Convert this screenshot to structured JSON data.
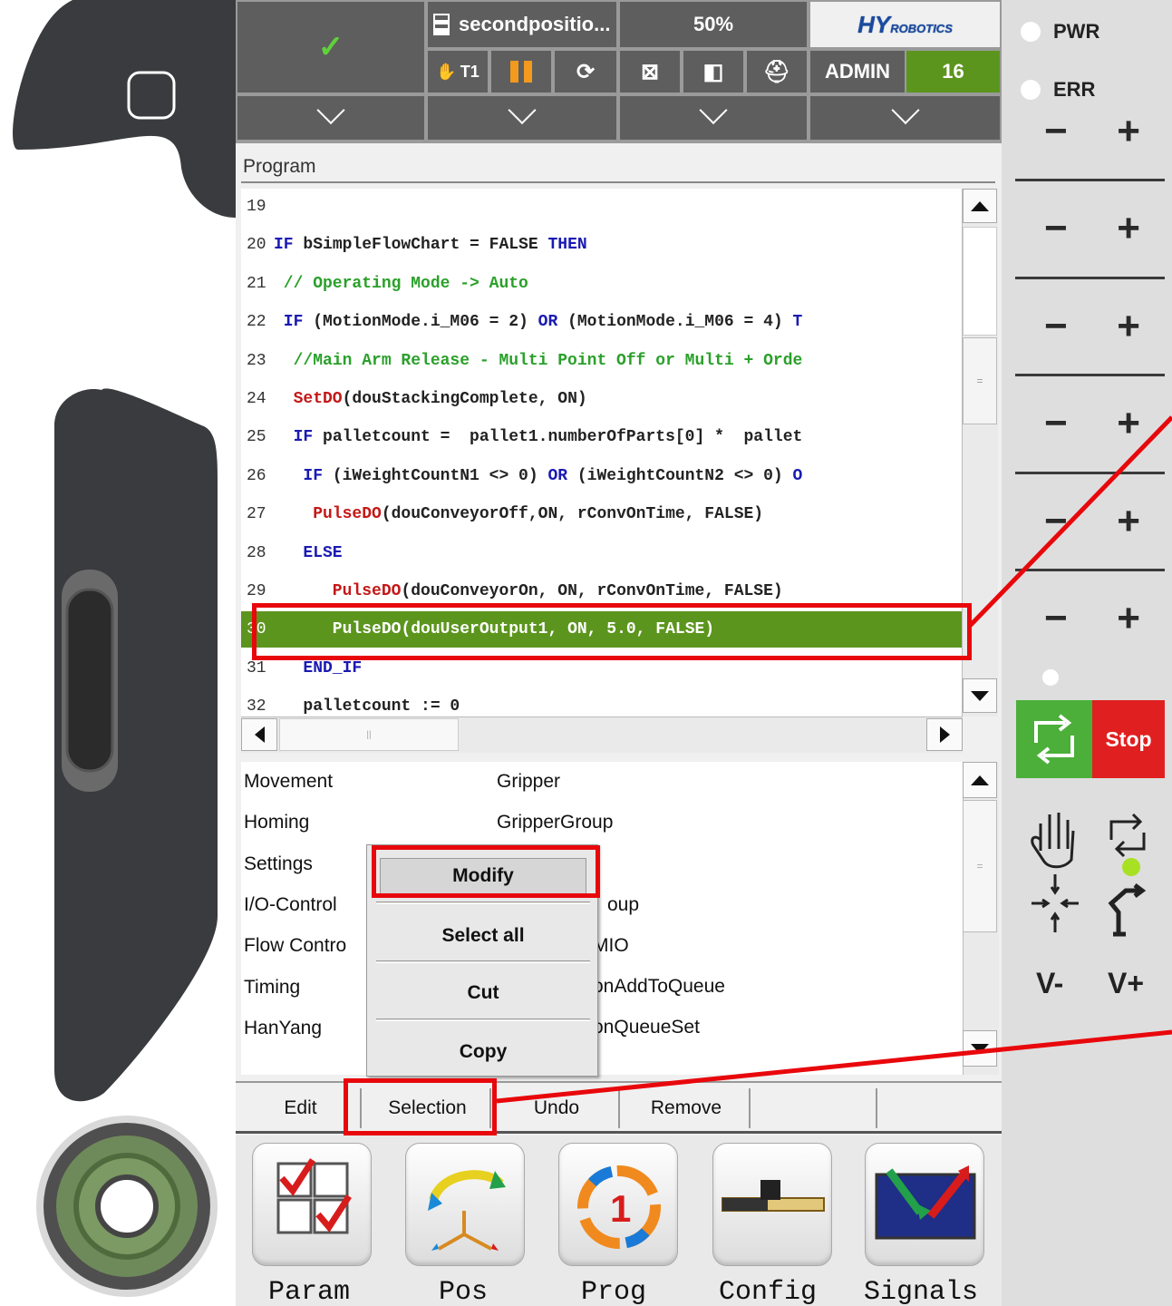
{
  "status_bar": {
    "program_name": "secondpositio...",
    "override": "50%",
    "brand": "HYROBOTICS",
    "mode": "T1",
    "user": "ADMIN",
    "user_level": "16"
  },
  "pendant": {
    "pwr_label": "PWR",
    "err_label": "ERR",
    "stop_label": "Stop",
    "v_minus": "V-",
    "v_plus": "V+"
  },
  "program": {
    "title": "Program",
    "lines": [
      {
        "n": "19",
        "parts": [
          {
            "c": "tx",
            "t": ""
          }
        ]
      },
      {
        "n": "20",
        "parts": [
          {
            "c": "kw",
            "t": "IF"
          },
          {
            "c": "tx",
            "t": " bSimpleFlowChart = FALSE "
          },
          {
            "c": "kw",
            "t": "THEN"
          }
        ]
      },
      {
        "n": "21",
        "parts": [
          {
            "c": "cm",
            "t": " // Operating Mode -> Auto"
          }
        ]
      },
      {
        "n": "22",
        "parts": [
          {
            "c": "kw",
            "t": " IF"
          },
          {
            "c": "tx",
            "t": " (MotionMode.i_M06 = 2) "
          },
          {
            "c": "kw",
            "t": "OR"
          },
          {
            "c": "tx",
            "t": " (MotionMode.i_M06 = 4) "
          },
          {
            "c": "kw",
            "t": "T"
          }
        ]
      },
      {
        "n": "23",
        "parts": [
          {
            "c": "cm",
            "t": "  //Main Arm Release - Multi Point Off or Multi + Orde"
          }
        ]
      },
      {
        "n": "24",
        "parts": [
          {
            "c": "fn",
            "t": "  SetDO"
          },
          {
            "c": "tx",
            "t": "(douStackingComplete, ON)"
          }
        ]
      },
      {
        "n": "25",
        "parts": [
          {
            "c": "kw",
            "t": "  IF"
          },
          {
            "c": "tx",
            "t": " palletcount =  pallet1.numberOfParts[0] *  pallet"
          }
        ]
      },
      {
        "n": "26",
        "parts": [
          {
            "c": "kw",
            "t": "   IF"
          },
          {
            "c": "tx",
            "t": " (iWeightCountN1 <> 0) "
          },
          {
            "c": "kw",
            "t": "OR"
          },
          {
            "c": "tx",
            "t": " (iWeightCountN2 <> 0) "
          },
          {
            "c": "kw",
            "t": "O"
          }
        ]
      },
      {
        "n": "27",
        "parts": [
          {
            "c": "fn",
            "t": "    PulseDO"
          },
          {
            "c": "tx",
            "t": "(douConveyorOff,ON, rConvOnTime, FALSE)"
          }
        ]
      },
      {
        "n": "28",
        "parts": [
          {
            "c": "kw",
            "t": "   ELSE"
          }
        ]
      },
      {
        "n": "29",
        "parts": [
          {
            "c": "fn",
            "t": "      PulseDO"
          },
          {
            "c": "tx",
            "t": "(douConveyorOn, ON, rConvOnTime, FALSE)"
          }
        ]
      },
      {
        "n": "30",
        "parts": [
          {
            "c": "fn",
            "t": "      PulseDO"
          },
          {
            "c": "tx",
            "t": "(douUserOutput1, ON, 5.0, FALSE)"
          }
        ],
        "highlight": true
      },
      {
        "n": "31",
        "parts": [
          {
            "c": "kw",
            "t": "   END_IF"
          }
        ]
      },
      {
        "n": "32",
        "parts": [
          {
            "c": "tx",
            "t": "   palletcount := 0"
          }
        ]
      }
    ]
  },
  "commands": {
    "left": [
      "Movement",
      "Homing",
      "Settings",
      "I/O-Control",
      "Flow Contro",
      "Timing",
      "HanYang"
    ],
    "right": [
      "Gripper",
      "GripperGroup",
      "oup",
      "MIO",
      "onAddToQueue",
      "onQueueSet"
    ]
  },
  "context_menu": {
    "items": [
      "Modify",
      "Select all",
      "Cut",
      "Copy"
    ]
  },
  "edit_tabs": [
    "Edit",
    "Selection",
    "Undo",
    "Remove"
  ],
  "nav": [
    "Param",
    "Pos",
    "Prog",
    "Config",
    "Signals"
  ],
  "colors": {
    "highlight": "#5c951e",
    "annotation": "#e8080c",
    "stop": "#e02020",
    "start": "#4caf3a",
    "user_level_bg": "#5c951e"
  }
}
